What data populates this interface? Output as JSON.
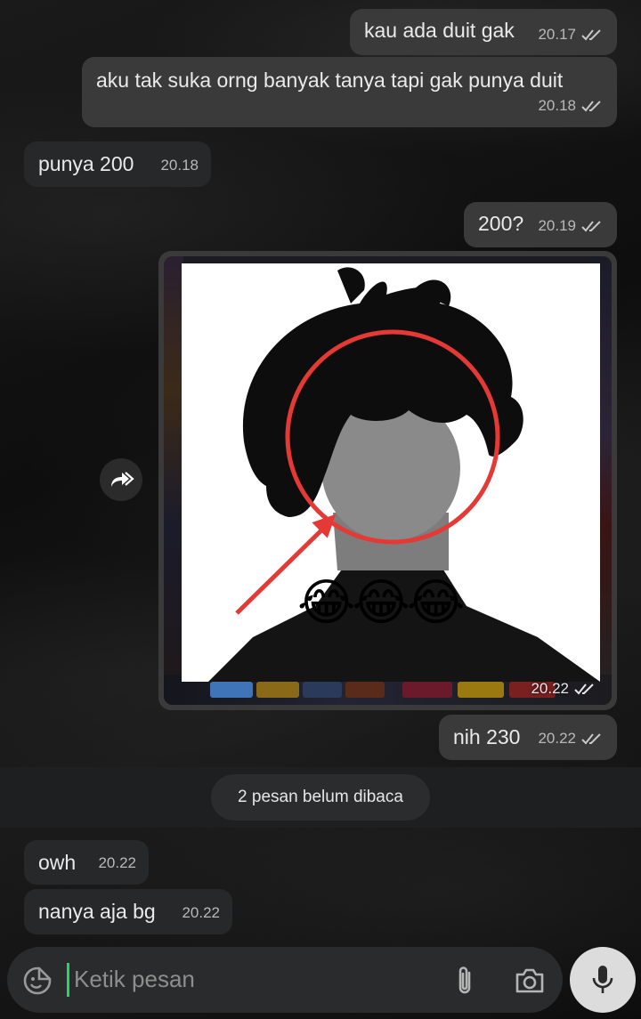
{
  "messages": [
    {
      "direction": "out",
      "text": "kau ada duit gak",
      "time": "20.17"
    },
    {
      "direction": "out",
      "text": "aku tak suka orng banyak tanya tapi gak punya duit",
      "time": "20.18"
    },
    {
      "direction": "in",
      "text": "punya 200",
      "time": "20.18"
    },
    {
      "direction": "out",
      "text": "200?",
      "time": "20.19"
    },
    {
      "direction": "out",
      "type": "image",
      "time": "20.22",
      "emoji": "😂😂😂"
    },
    {
      "direction": "out",
      "text": "nih 230",
      "time": "20.22"
    },
    {
      "direction": "in",
      "text": "owh",
      "time": "20.22"
    },
    {
      "direction": "in",
      "text": "nanya aja bg",
      "time": "20.22"
    }
  ],
  "unread_banner": "2 pesan belum dibaca",
  "composer": {
    "placeholder": "Ketik pesan",
    "icons": [
      "sticker-icon",
      "attach-icon",
      "camera-icon",
      "mic-icon"
    ]
  },
  "icons": {
    "read_receipt": "double-check-icon",
    "forward": "forward-icon"
  },
  "colors": {
    "outgoing_bubble": "#3a3a3a",
    "incoming_bubble": "#262829",
    "cursor": "#25d366",
    "circle": "#e53935"
  }
}
